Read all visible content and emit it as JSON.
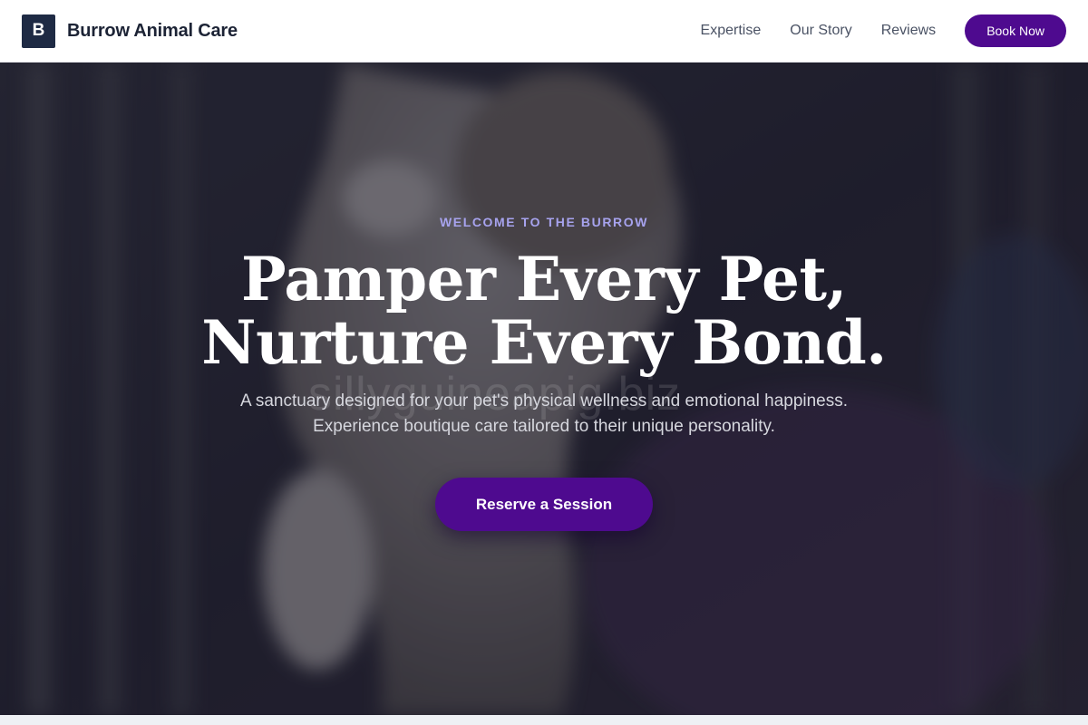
{
  "nav": {
    "logo_letter": "B",
    "brand": "Burrow Animal Care",
    "links": [
      "Expertise",
      "Our Story",
      "Reviews"
    ],
    "cta_label": "Book Now"
  },
  "hero": {
    "eyebrow": "WELCOME TO THE BURROW",
    "headline_line1": "Pamper Every Pet,",
    "headline_line2": "Nurture Every Bond.",
    "subtext": "A sanctuary designed for your pet's physical wellness and emotional happiness. Experience boutique care tailored to their unique personality.",
    "cta_label": "Reserve a Session",
    "background_image": "blurred-cat-photo",
    "watermark": "sillyguineapig.biz"
  },
  "colors": {
    "accent": "#4e0a8f",
    "logo_bg": "#1e2a44",
    "eyebrow": "#a7a3ee"
  }
}
